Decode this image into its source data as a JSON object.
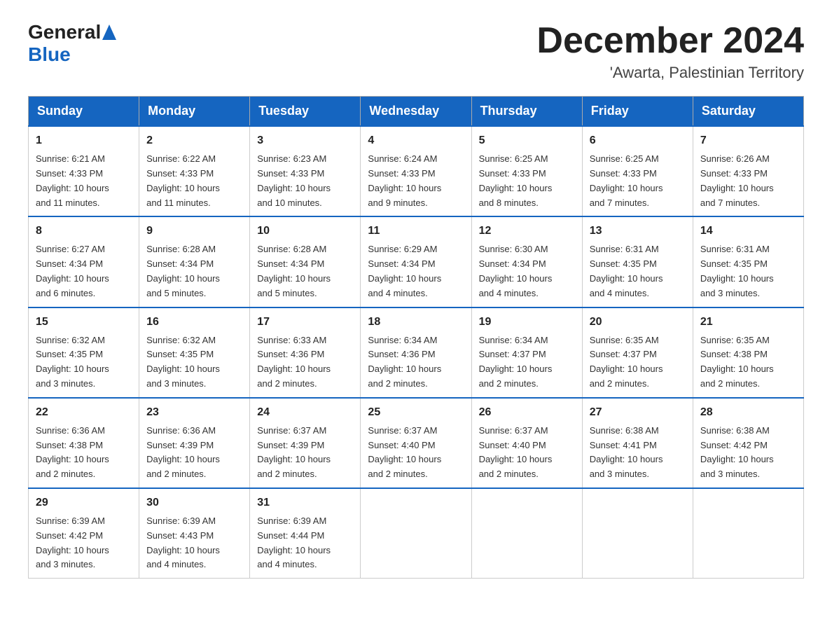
{
  "header": {
    "logo_general": "General",
    "logo_blue": "Blue",
    "month_title": "December 2024",
    "location": "'Awarta, Palestinian Territory"
  },
  "calendar": {
    "days_of_week": [
      "Sunday",
      "Monday",
      "Tuesday",
      "Wednesday",
      "Thursday",
      "Friday",
      "Saturday"
    ],
    "weeks": [
      [
        {
          "day": "1",
          "sunrise": "6:21 AM",
          "sunset": "4:33 PM",
          "daylight": "10 hours and 11 minutes."
        },
        {
          "day": "2",
          "sunrise": "6:22 AM",
          "sunset": "4:33 PM",
          "daylight": "10 hours and 11 minutes."
        },
        {
          "day": "3",
          "sunrise": "6:23 AM",
          "sunset": "4:33 PM",
          "daylight": "10 hours and 10 minutes."
        },
        {
          "day": "4",
          "sunrise": "6:24 AM",
          "sunset": "4:33 PM",
          "daylight": "10 hours and 9 minutes."
        },
        {
          "day": "5",
          "sunrise": "6:25 AM",
          "sunset": "4:33 PM",
          "daylight": "10 hours and 8 minutes."
        },
        {
          "day": "6",
          "sunrise": "6:25 AM",
          "sunset": "4:33 PM",
          "daylight": "10 hours and 7 minutes."
        },
        {
          "day": "7",
          "sunrise": "6:26 AM",
          "sunset": "4:33 PM",
          "daylight": "10 hours and 7 minutes."
        }
      ],
      [
        {
          "day": "8",
          "sunrise": "6:27 AM",
          "sunset": "4:34 PM",
          "daylight": "10 hours and 6 minutes."
        },
        {
          "day": "9",
          "sunrise": "6:28 AM",
          "sunset": "4:34 PM",
          "daylight": "10 hours and 5 minutes."
        },
        {
          "day": "10",
          "sunrise": "6:28 AM",
          "sunset": "4:34 PM",
          "daylight": "10 hours and 5 minutes."
        },
        {
          "day": "11",
          "sunrise": "6:29 AM",
          "sunset": "4:34 PM",
          "daylight": "10 hours and 4 minutes."
        },
        {
          "day": "12",
          "sunrise": "6:30 AM",
          "sunset": "4:34 PM",
          "daylight": "10 hours and 4 minutes."
        },
        {
          "day": "13",
          "sunrise": "6:31 AM",
          "sunset": "4:35 PM",
          "daylight": "10 hours and 4 minutes."
        },
        {
          "day": "14",
          "sunrise": "6:31 AM",
          "sunset": "4:35 PM",
          "daylight": "10 hours and 3 minutes."
        }
      ],
      [
        {
          "day": "15",
          "sunrise": "6:32 AM",
          "sunset": "4:35 PM",
          "daylight": "10 hours and 3 minutes."
        },
        {
          "day": "16",
          "sunrise": "6:32 AM",
          "sunset": "4:35 PM",
          "daylight": "10 hours and 3 minutes."
        },
        {
          "day": "17",
          "sunrise": "6:33 AM",
          "sunset": "4:36 PM",
          "daylight": "10 hours and 2 minutes."
        },
        {
          "day": "18",
          "sunrise": "6:34 AM",
          "sunset": "4:36 PM",
          "daylight": "10 hours and 2 minutes."
        },
        {
          "day": "19",
          "sunrise": "6:34 AM",
          "sunset": "4:37 PM",
          "daylight": "10 hours and 2 minutes."
        },
        {
          "day": "20",
          "sunrise": "6:35 AM",
          "sunset": "4:37 PM",
          "daylight": "10 hours and 2 minutes."
        },
        {
          "day": "21",
          "sunrise": "6:35 AM",
          "sunset": "4:38 PM",
          "daylight": "10 hours and 2 minutes."
        }
      ],
      [
        {
          "day": "22",
          "sunrise": "6:36 AM",
          "sunset": "4:38 PM",
          "daylight": "10 hours and 2 minutes."
        },
        {
          "day": "23",
          "sunrise": "6:36 AM",
          "sunset": "4:39 PM",
          "daylight": "10 hours and 2 minutes."
        },
        {
          "day": "24",
          "sunrise": "6:37 AM",
          "sunset": "4:39 PM",
          "daylight": "10 hours and 2 minutes."
        },
        {
          "day": "25",
          "sunrise": "6:37 AM",
          "sunset": "4:40 PM",
          "daylight": "10 hours and 2 minutes."
        },
        {
          "day": "26",
          "sunrise": "6:37 AM",
          "sunset": "4:40 PM",
          "daylight": "10 hours and 2 minutes."
        },
        {
          "day": "27",
          "sunrise": "6:38 AM",
          "sunset": "4:41 PM",
          "daylight": "10 hours and 3 minutes."
        },
        {
          "day": "28",
          "sunrise": "6:38 AM",
          "sunset": "4:42 PM",
          "daylight": "10 hours and 3 minutes."
        }
      ],
      [
        {
          "day": "29",
          "sunrise": "6:39 AM",
          "sunset": "4:42 PM",
          "daylight": "10 hours and 3 minutes."
        },
        {
          "day": "30",
          "sunrise": "6:39 AM",
          "sunset": "4:43 PM",
          "daylight": "10 hours and 4 minutes."
        },
        {
          "day": "31",
          "sunrise": "6:39 AM",
          "sunset": "4:44 PM",
          "daylight": "10 hours and 4 minutes."
        },
        null,
        null,
        null,
        null
      ]
    ],
    "labels": {
      "sunrise": "Sunrise:",
      "sunset": "Sunset:",
      "daylight": "Daylight:"
    }
  }
}
